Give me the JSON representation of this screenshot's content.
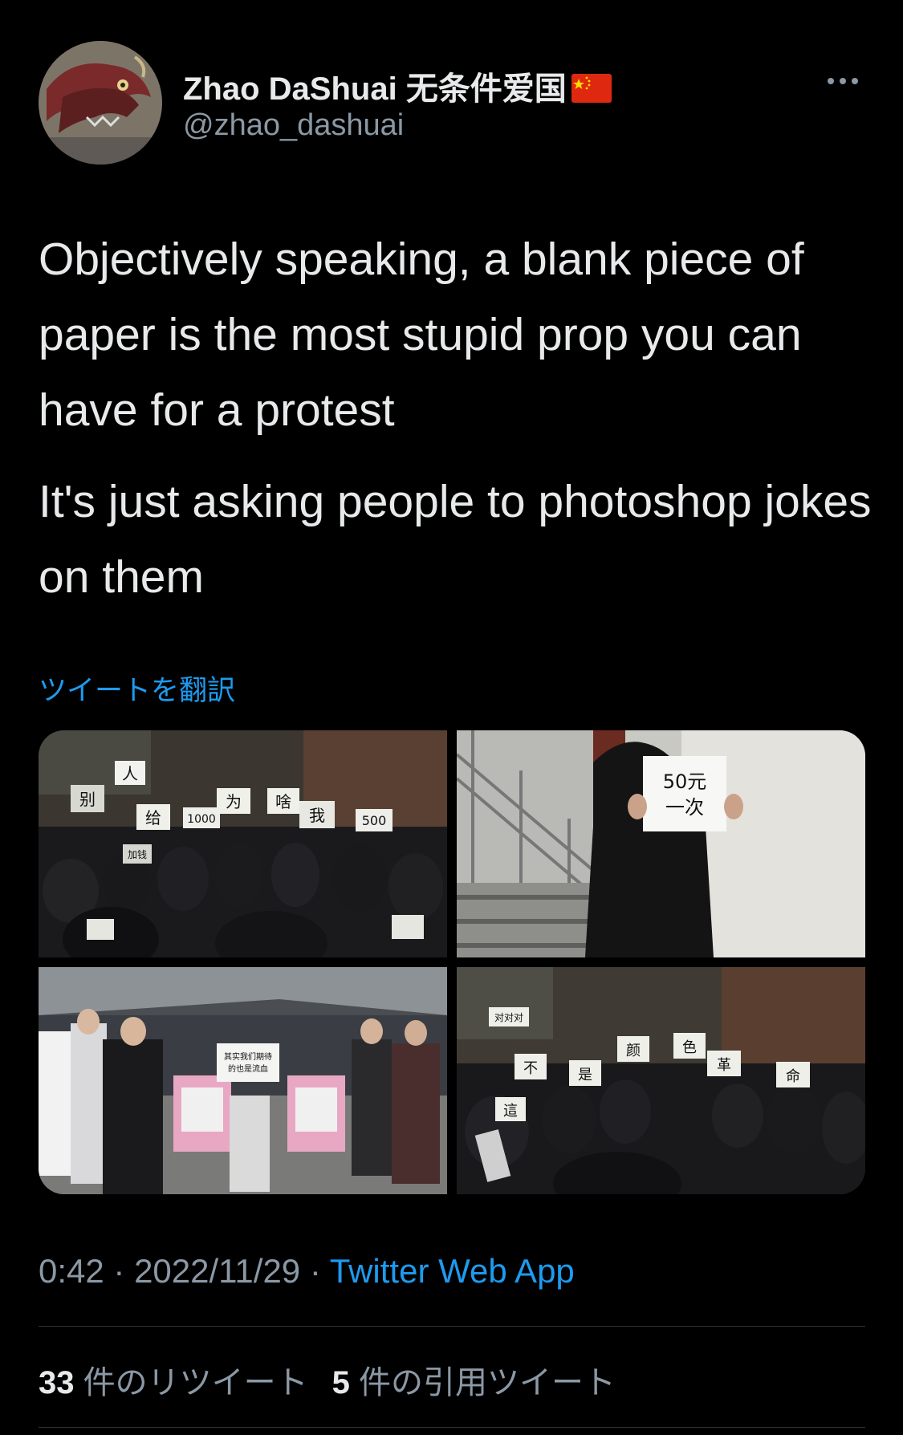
{
  "user": {
    "display_name": "Zhao DaShuai 无条件爱国",
    "flag_icon": "china-flag-icon",
    "handle": "@zhao_dashuai",
    "avatar_icon": "dragon-avatar"
  },
  "tweet": {
    "paragraphs": [
      "Objectively speaking, a blank piece of paper is the most stupid prop you can have for a protest",
      "It's just asking people to photoshop jokes on them"
    ],
    "translate_label": "ツイートを翻訳"
  },
  "media": {
    "photo1_signs": [
      "人",
      "别",
      "给",
      "1000",
      "为",
      "啥",
      "我",
      "500",
      "加钱"
    ],
    "photo2_sign_lines": [
      "50元",
      "一次"
    ],
    "photo3_sign_lines": [
      "其实我们期待",
      "的也是流血"
    ],
    "photo4_signs": [
      "对对对",
      "不",
      "是",
      "颜",
      "色",
      "革",
      "命",
      "這"
    ]
  },
  "meta": {
    "time": "0:42",
    "sep1": " · ",
    "date": "2022/11/29",
    "sep2": " · ",
    "source": "Twitter Web App"
  },
  "stats": {
    "retweets_count": "33",
    "retweets_label": "件のリツイート",
    "quotes_count": "5",
    "quotes_label": "件の引用ツイート"
  },
  "colors": {
    "background": "#000000",
    "text": "#e7e9ea",
    "secondary": "#8b98a5",
    "accent": "#1d9bf0"
  }
}
